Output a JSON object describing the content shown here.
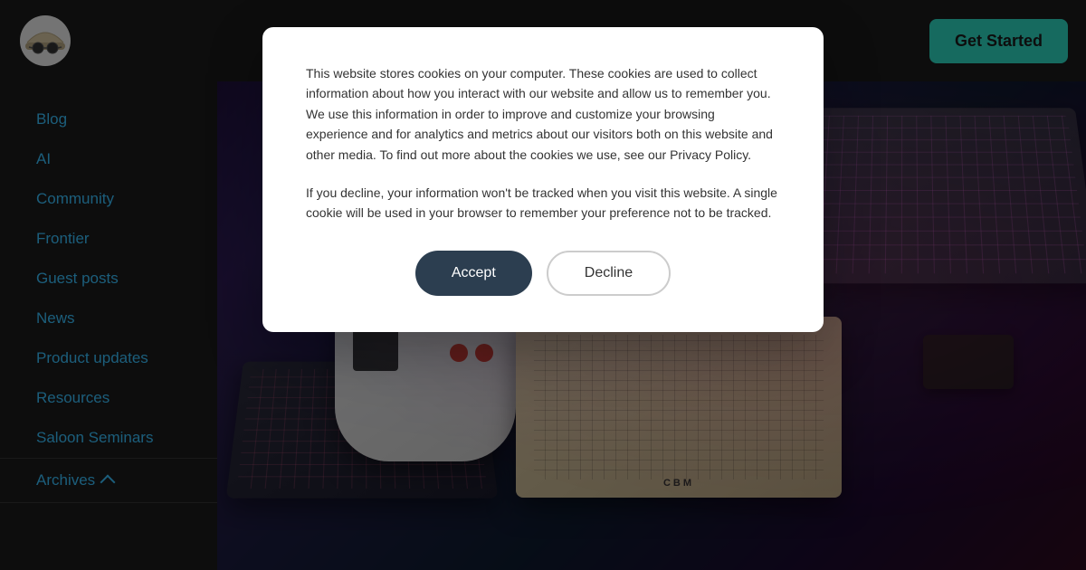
{
  "navbar": {
    "get_started_label": "Get Started"
  },
  "sidebar": {
    "items": [
      {
        "label": "Blog",
        "id": "blog"
      },
      {
        "label": "AI",
        "id": "ai"
      },
      {
        "label": "Community",
        "id": "community"
      },
      {
        "label": "Frontier",
        "id": "frontier"
      },
      {
        "label": "Guest posts",
        "id": "guest-posts"
      },
      {
        "label": "News",
        "id": "news"
      },
      {
        "label": "Product updates",
        "id": "product-updates"
      },
      {
        "label": "Resources",
        "id": "resources"
      },
      {
        "label": "Saloon Seminars",
        "id": "saloon-seminars"
      },
      {
        "label": "Archives",
        "id": "archives"
      }
    ]
  },
  "cookie": {
    "paragraph1": "This website stores cookies on your computer. These cookies are used to collect information about how you interact with our website and allow us to remember you. We use this information in order to improve and customize your browsing experience and for analytics and metrics about our visitors both on this website and other media. To find out more about the cookies we use, see our Privacy Policy.",
    "paragraph2": "If you decline, your information won't be tracked when you visit this website. A single cookie will be used in your browser to remember your preference not to be tracked.",
    "accept_label": "Accept",
    "decline_label": "Decline",
    "privacy_policy_text": "Privacy Policy"
  }
}
